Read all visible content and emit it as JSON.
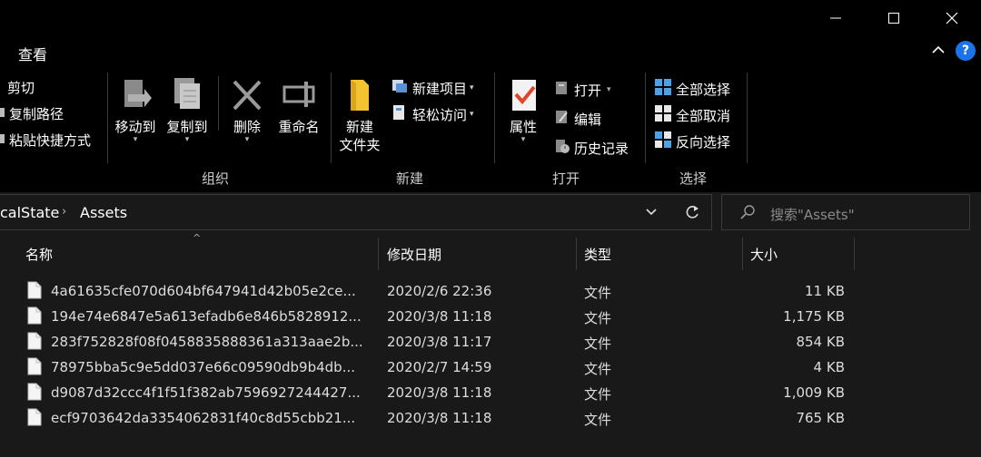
{
  "tabs": {
    "view": "查看"
  },
  "ribbon": {
    "cut": "剪切",
    "copy_path": "复制路径",
    "paste_shortcut": "粘贴快捷方式",
    "move_to": "移动到",
    "copy_to": "复制到",
    "delete": "删除",
    "rename": "重命名",
    "new_folder_line1": "新建",
    "new_folder_line2": "文件夹",
    "new_item": "新建项目",
    "easy_access": "轻松访问",
    "properties": "属性",
    "open": "打开",
    "edit": "编辑",
    "history": "历史记录",
    "select_all": "全部选择",
    "select_none": "全部取消",
    "invert_selection": "反向选择",
    "groups": {
      "organize": "组织",
      "new": "新建",
      "open": "打开",
      "select": "选择"
    }
  },
  "address": {
    "crumbs": [
      "calState",
      "Assets"
    ],
    "search_placeholder": "搜索\"Assets\""
  },
  "columns": {
    "name": "名称",
    "date": "修改日期",
    "type": "类型",
    "size": "大小"
  },
  "files": [
    {
      "name": "4a61635cfe070d604bf647941d42b05e2ce...",
      "date": "2020/2/6 22:36",
      "type": "文件",
      "size": "11 KB"
    },
    {
      "name": "194e74e6847e5a613efadb6e846b5828912...",
      "date": "2020/3/8 11:18",
      "type": "文件",
      "size": "1,175 KB"
    },
    {
      "name": "283f752828f08f0458835888361a313aae2b...",
      "date": "2020/3/8 11:17",
      "type": "文件",
      "size": "854 KB"
    },
    {
      "name": "78975bba5c9e5dd037e66c09590db9b4db...",
      "date": "2020/2/7 14:59",
      "type": "文件",
      "size": "4 KB"
    },
    {
      "name": "d9087d32ccc4f1f51f382ab7596927244427...",
      "date": "2020/3/8 11:18",
      "type": "文件",
      "size": "1,009 KB"
    },
    {
      "name": "ecf9703642da3354062831f40c8d55cbb21...",
      "date": "2020/3/8 11:18",
      "type": "文件",
      "size": "765 KB"
    }
  ],
  "help": "?"
}
